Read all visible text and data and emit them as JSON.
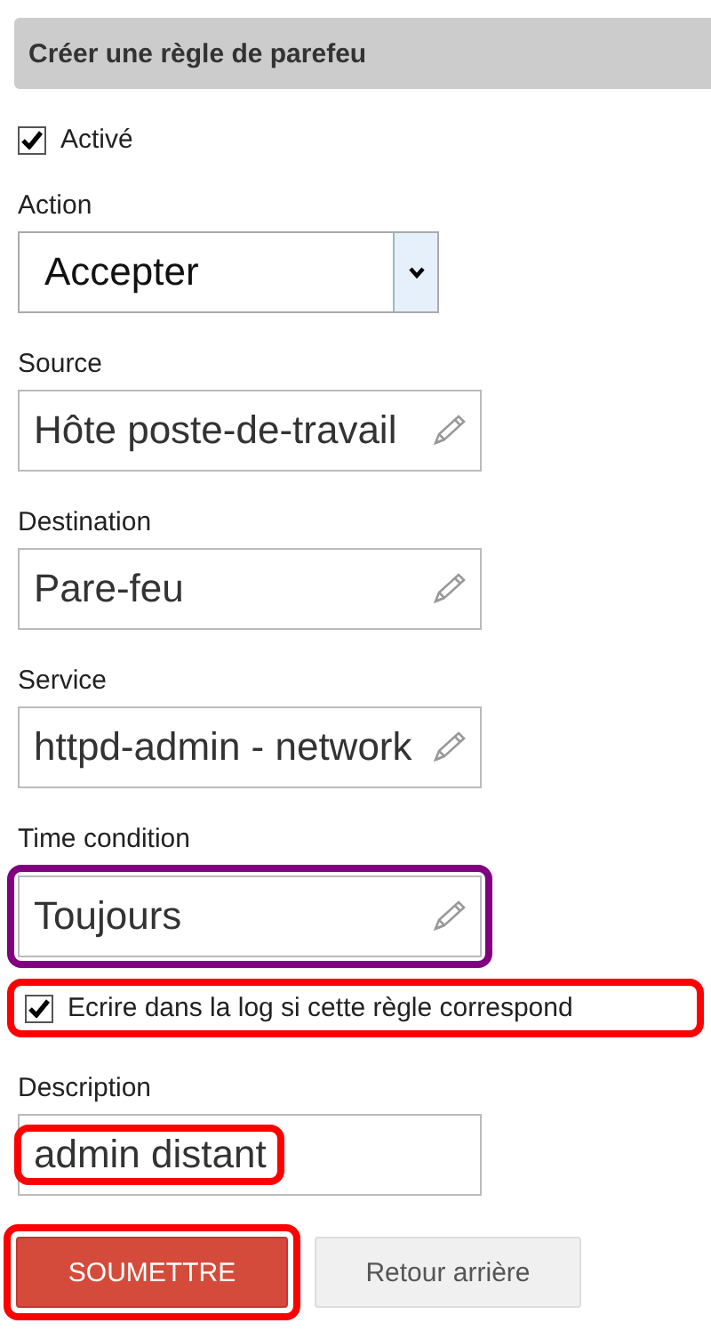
{
  "panel": {
    "title": "Créer une règle de parefeu"
  },
  "fields": [
    {
      "kind": "checkbox",
      "label": "Activé",
      "checked": true
    },
    {
      "kind": "select",
      "label": "Action",
      "value": "Accepter"
    },
    {
      "kind": "picker",
      "label": "Source",
      "value": "Hôte poste-de-travail"
    },
    {
      "kind": "picker",
      "label": "Destination",
      "value": "Pare-feu"
    },
    {
      "kind": "picker",
      "label": "Service",
      "value": "httpd-admin - network"
    },
    {
      "kind": "picker",
      "label": "Time condition",
      "value": "Toujours",
      "color": "#800080"
    },
    {
      "kind": "checkbox",
      "label": "Ecrire dans la log si cette règle correspond",
      "checked": true,
      "color": "#ff0000"
    },
    {
      "kind": "text",
      "label": "Description",
      "value": "admin distant",
      "color": "#ff0000"
    }
  ],
  "buttons": [
    {
      "kind": "primary",
      "label": "SOUMETTRE",
      "color": "#ff0000"
    },
    {
      "kind": "secondary",
      "label": "Retour arrière"
    }
  ]
}
